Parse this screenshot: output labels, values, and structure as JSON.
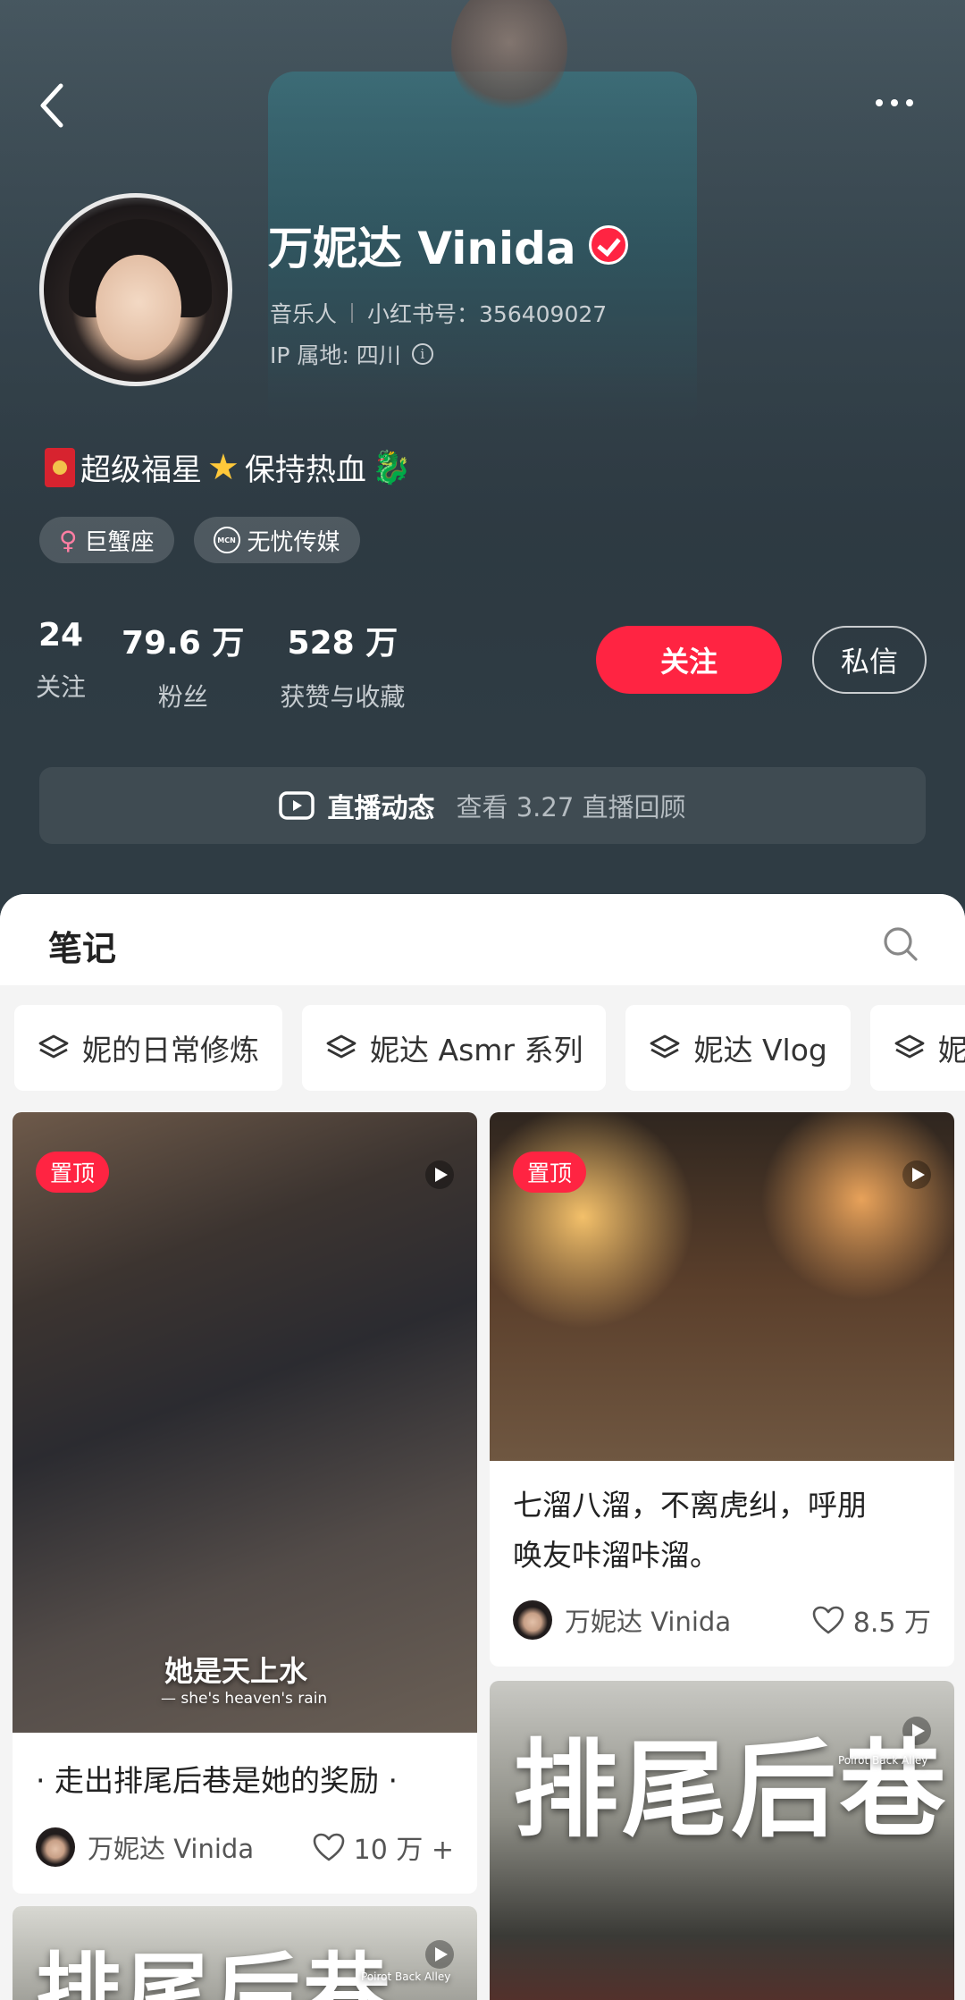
{
  "profile": {
    "name": "万妮达 Vinida",
    "occupation": "音乐人",
    "redbook_id_label": "小红书号：356409027",
    "ip_location": "IP 属地: 四川",
    "bio": {
      "part1": "超级福星",
      "part2": "保持热血"
    },
    "tags": [
      {
        "label": "巨蟹座",
        "icon": "female-icon"
      },
      {
        "label": "无忧传媒",
        "icon": "mcn-icon"
      }
    ],
    "stats": [
      {
        "value": "24",
        "label": "关注"
      },
      {
        "value": "79.6 万",
        "label": "粉丝"
      },
      {
        "value": "528 万",
        "label": "获赞与收藏"
      }
    ],
    "follow_label": "关注",
    "message_label": "私信"
  },
  "live": {
    "title": "直播动态",
    "subtitle": "查看 3.27 直播回顾"
  },
  "notes": {
    "title": "笔记",
    "collections": [
      "妮的日常修炼",
      "妮达 Asmr 系列",
      "妮达 Vlog",
      "妮"
    ]
  },
  "cards": [
    {
      "pin_label": "置顶",
      "overlay_main": "她是天上水",
      "overlay_sub": "— she's heaven's rain",
      "caption": "· 走出排尾后巷是她的奖励 ·",
      "author": "万妮达 Vinida",
      "likes": "10 万 +"
    },
    {
      "pin_label": "置顶",
      "caption_line1": "七溜八溜，不离虎纠，呼朋",
      "caption_line2": "唤友咔溜咔溜。",
      "author": "万妮达 Vinida",
      "likes": "8.5 万"
    },
    {
      "calligraphy": "排尾后巷",
      "small_en": "Poirot Back Alley"
    },
    {
      "calligraphy": "排尾后巷",
      "small_en": "Poirot Back Alley"
    }
  ],
  "colors": {
    "accent": "#ff2442",
    "hero_bg": "#2f3c44"
  }
}
